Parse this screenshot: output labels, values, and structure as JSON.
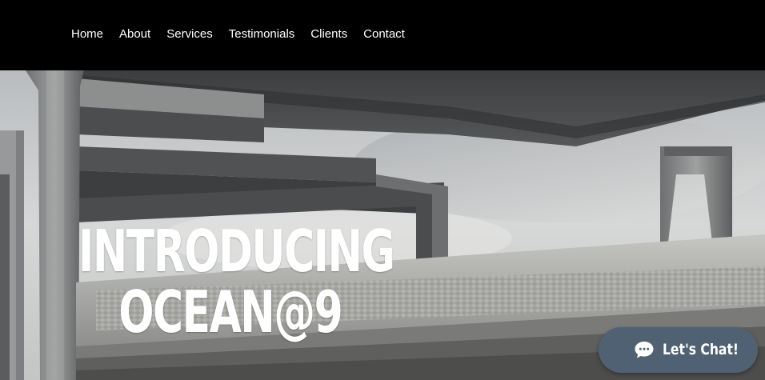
{
  "nav": {
    "items": [
      {
        "label": "Home"
      },
      {
        "label": "About"
      },
      {
        "label": "Services"
      },
      {
        "label": "Testimonials"
      },
      {
        "label": "Clients"
      },
      {
        "label": "Contact"
      }
    ]
  },
  "hero": {
    "headline_line1": "INTRODUCING",
    "headline_line2": "OCEAN@9"
  },
  "chat": {
    "label": "Let's Chat!",
    "icon": "chat-bubble-icon"
  },
  "colors": {
    "header_bg": "#000000",
    "nav_text": "#ffffff",
    "chat_bg": "#4f6172",
    "headline": "#ffffff"
  }
}
